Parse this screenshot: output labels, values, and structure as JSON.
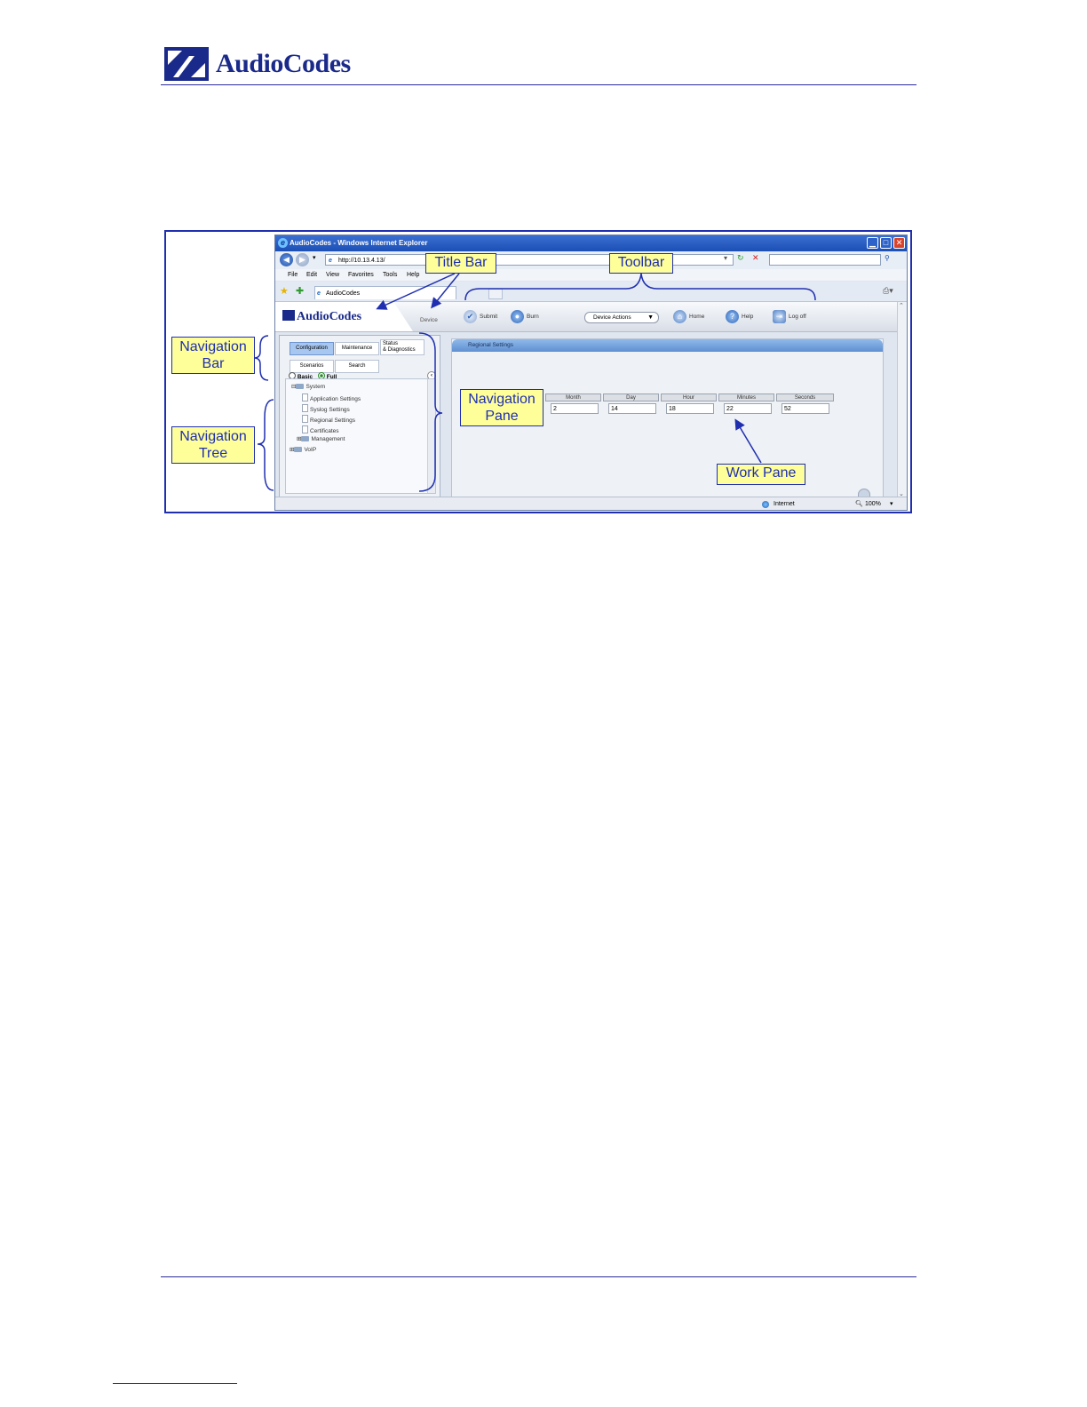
{
  "header": {
    "brand": "AudioCodes"
  },
  "browser": {
    "title": "AudioCodes - Windows Internet Explorer",
    "address": "http://10.13.4.13/",
    "menu": [
      "File",
      "Edit",
      "View",
      "Favorites",
      "Tools",
      "Help"
    ],
    "tab_label": "AudioCodes",
    "status_zone": "Internet",
    "zoom": "100%"
  },
  "app": {
    "logo": "AudioCodes",
    "device_label": "Device",
    "toolbar": {
      "submit": "Submit",
      "burn": "Burn",
      "device_actions": "Device Actions",
      "home": "Home",
      "help": "Help",
      "logoff": "Log off"
    },
    "navbar": {
      "configuration": "Configuration",
      "maintenance": "Maintenance",
      "status_line1": "Status",
      "status_line2": "& Diagnostics",
      "scenarios": "Scenarios",
      "search": "Search"
    },
    "view_mode": {
      "basic": "Basic",
      "full": "Full"
    },
    "tree": {
      "system": "System",
      "app_settings": "Application Settings",
      "syslog": "Syslog Settings",
      "regional": "Regional Settings",
      "certificates": "Certificates",
      "management": "Management",
      "voip": "VoIP"
    },
    "work_pane": {
      "title": "Regional Settings",
      "headers": {
        "month": "Month",
        "day": "Day",
        "hour": "Hour",
        "minutes": "Minutes",
        "seconds": "Seconds"
      },
      "values": {
        "month": "2",
        "day": "14",
        "hour": "18",
        "minutes": "22",
        "seconds": "52"
      }
    }
  },
  "callouts": {
    "title_bar": "Title Bar",
    "toolbar": "Toolbar",
    "nav_bar_1": "Navigation",
    "nav_bar_2": "Bar",
    "nav_tree_1": "Navigation",
    "nav_tree_2": "Tree",
    "nav_pane_1": "Navigation",
    "nav_pane_2": "Pane",
    "work_pane": "Work Pane"
  },
  "colors": {
    "brand": "#1a2a8a",
    "callout_fill": "#ffff99",
    "callout_border": "#1f2fb0"
  }
}
